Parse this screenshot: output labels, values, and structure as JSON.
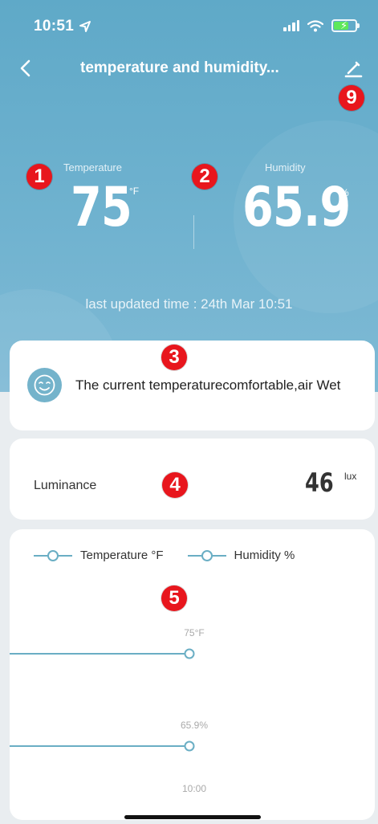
{
  "status_bar": {
    "time": "10:51"
  },
  "nav": {
    "title": "temperature and humidity..."
  },
  "markers": [
    "1",
    "2",
    "3",
    "4",
    "5",
    "9"
  ],
  "temperature": {
    "label": "Temperature",
    "value": "75",
    "unit": "°F"
  },
  "humidity": {
    "label": "Humidity",
    "value": "65.9",
    "unit": "%"
  },
  "last_updated": "last updated time : 24th Mar 10:51",
  "comfort": {
    "text": "The current temperaturecomfortable,air Wet"
  },
  "luminance": {
    "label": "Luminance",
    "value": "46",
    "unit": "lux"
  },
  "chart_data": {
    "type": "line",
    "x": [
      "10:00"
    ],
    "series": [
      {
        "name": "Temperature °F",
        "values": [
          75
        ],
        "point_label": "75°F"
      },
      {
        "name": "Humidity %",
        "values": [
          65.9
        ],
        "point_label": "65.9%"
      }
    ],
    "legend": "top-left",
    "grid": false,
    "colors": {
      "line": "#6aaec4"
    }
  }
}
